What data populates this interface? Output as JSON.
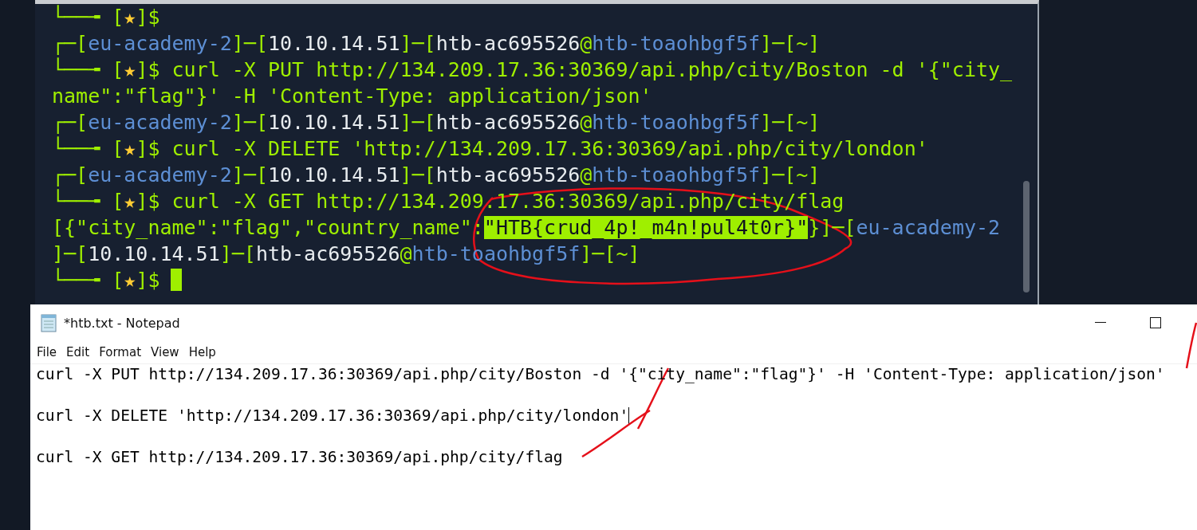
{
  "terminal": {
    "lines": [
      [
        {
          "kind": "frame",
          "text": "└──╼ ["
        },
        {
          "kind": "star",
          "text": "★"
        },
        {
          "kind": "frame",
          "text": "]$"
        }
      ],
      [
        {
          "kind": "frame",
          "text": "┌─["
        },
        {
          "kind": "host",
          "text": "eu-academy-2"
        },
        {
          "kind": "frame",
          "text": "]─["
        },
        {
          "kind": "ip",
          "text": "10.10.14.51"
        },
        {
          "kind": "frame",
          "text": "]─["
        },
        {
          "kind": "ip",
          "text": "htb-ac695526"
        },
        {
          "kind": "frame",
          "text": "@"
        },
        {
          "kind": "host",
          "text": "htb-toaohbgf5f"
        },
        {
          "kind": "frame",
          "text": "]─[~]"
        }
      ],
      [
        {
          "kind": "frame",
          "text": "└──╼ ["
        },
        {
          "kind": "star",
          "text": "★"
        },
        {
          "kind": "frame",
          "text": "]$ curl -X PUT http://134.209.17.36:30369/api.php/city/Boston -d '{\"city_"
        }
      ],
      [
        {
          "kind": "frame",
          "text": "name\":\"flag\"}' -H 'Content-Type: application/json'"
        }
      ],
      [
        {
          "kind": "frame",
          "text": "┌─["
        },
        {
          "kind": "host",
          "text": "eu-academy-2"
        },
        {
          "kind": "frame",
          "text": "]─["
        },
        {
          "kind": "ip",
          "text": "10.10.14.51"
        },
        {
          "kind": "frame",
          "text": "]─["
        },
        {
          "kind": "ip",
          "text": "htb-ac695526"
        },
        {
          "kind": "frame",
          "text": "@"
        },
        {
          "kind": "host",
          "text": "htb-toaohbgf5f"
        },
        {
          "kind": "frame",
          "text": "]─[~]"
        }
      ],
      [
        {
          "kind": "frame",
          "text": "└──╼ ["
        },
        {
          "kind": "star",
          "text": "★"
        },
        {
          "kind": "frame",
          "text": "]$ curl -X DELETE 'http://134.209.17.36:30369/api.php/city/london'"
        }
      ],
      [
        {
          "kind": "frame",
          "text": "┌─["
        },
        {
          "kind": "host",
          "text": "eu-academy-2"
        },
        {
          "kind": "frame",
          "text": "]─["
        },
        {
          "kind": "ip",
          "text": "10.10.14.51"
        },
        {
          "kind": "frame",
          "text": "]─["
        },
        {
          "kind": "ip",
          "text": "htb-ac695526"
        },
        {
          "kind": "frame",
          "text": "@"
        },
        {
          "kind": "host",
          "text": "htb-toaohbgf5f"
        },
        {
          "kind": "frame",
          "text": "]─[~]"
        }
      ],
      [
        {
          "kind": "frame",
          "text": "└──╼ ["
        },
        {
          "kind": "star",
          "text": "★"
        },
        {
          "kind": "frame",
          "text": "]$ curl -X GET http://134.209.17.36:30369/api.php/city/flag"
        }
      ],
      [
        {
          "kind": "frame",
          "text": "[{\"city_name\":\"flag\",\"country_name\":"
        },
        {
          "kind": "highlight",
          "text": "\"HTB{crud_4p!_m4n!pul4t0r}\""
        },
        {
          "kind": "frame",
          "text": "}]─["
        },
        {
          "kind": "host",
          "text": "eu-academy-2"
        }
      ],
      [
        {
          "kind": "frame",
          "text": "]─["
        },
        {
          "kind": "ip",
          "text": "10.10.14.51"
        },
        {
          "kind": "frame",
          "text": "]─["
        },
        {
          "kind": "ip",
          "text": "htb-ac695526"
        },
        {
          "kind": "frame",
          "text": "@"
        },
        {
          "kind": "host",
          "text": "htb-toaohbgf5f"
        },
        {
          "kind": "frame",
          "text": "]─[~]"
        }
      ],
      [
        {
          "kind": "frame",
          "text": "└──╼ ["
        },
        {
          "kind": "star",
          "text": "★"
        },
        {
          "kind": "frame",
          "text": "]$"
        },
        {
          "kind": "cursor"
        }
      ]
    ]
  },
  "notepad": {
    "title": "*htb.txt - Notepad",
    "menu": [
      "File",
      "Edit",
      "Format",
      "View",
      "Help"
    ],
    "lines": [
      {
        "text": "curl -X PUT http://134.209.17.36:30369/api.php/city/Boston -d '{\"city_name\":\"flag\"}' -H 'Content-Type: application/json'",
        "caret": false
      },
      {
        "text": "curl -X DELETE 'http://134.209.17.36:30369/api.php/city/london'",
        "caret": true
      },
      {
        "text": "curl -X GET http://134.209.17.36:30369/api.php/city/flag",
        "caret": false
      }
    ]
  }
}
